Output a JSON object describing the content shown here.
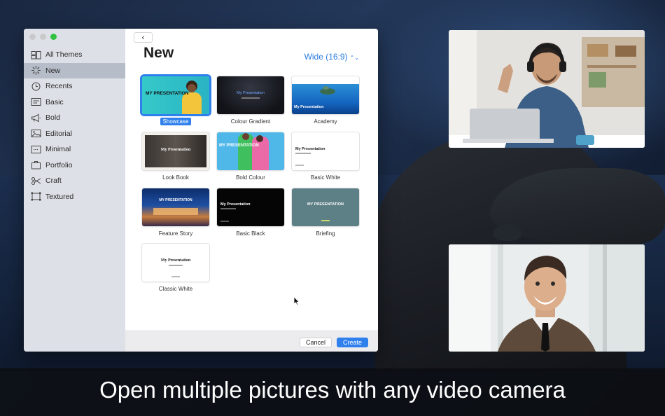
{
  "sidebar": {
    "items": [
      {
        "label": "All Themes",
        "icon": "all-themes-icon"
      },
      {
        "label": "New",
        "icon": "sparkle-icon"
      },
      {
        "label": "Recents",
        "icon": "clock-icon"
      },
      {
        "label": "Basic",
        "icon": "basic-slide-icon"
      },
      {
        "label": "Bold",
        "icon": "megaphone-icon"
      },
      {
        "label": "Editorial",
        "icon": "image-icon"
      },
      {
        "label": "Minimal",
        "icon": "minimal-icon"
      },
      {
        "label": "Portfolio",
        "icon": "briefcase-icon"
      },
      {
        "label": "Craft",
        "icon": "scissors-icon"
      },
      {
        "label": "Textured",
        "icon": "textured-icon"
      }
    ],
    "selected": "New"
  },
  "main": {
    "back_label": "‹",
    "title": "New",
    "aspect_label": "Wide (16:9)",
    "aspect_arrows": "⌃⌄",
    "themes": [
      {
        "label": "Showcase",
        "thumb_title": "MY PRESENTATION",
        "selected": true
      },
      {
        "label": "Colour Gradient",
        "thumb_title": "My Presentation"
      },
      {
        "label": "Academy",
        "thumb_title": "My Presentation"
      },
      {
        "label": "Look Book",
        "thumb_title": "My Presentation"
      },
      {
        "label": "Bold Colour",
        "thumb_title": "MY PRESENTATION"
      },
      {
        "label": "Basic White",
        "thumb_title": "My Presentation"
      },
      {
        "label": "Feature Story",
        "thumb_title": "MY PRESENTATION"
      },
      {
        "label": "Basic Black",
        "thumb_title": "My Presentation"
      },
      {
        "label": "Briefing",
        "thumb_title": "MY PRESENTATION"
      },
      {
        "label": "Classic White",
        "thumb_title": "My Presentation"
      }
    ]
  },
  "footer": {
    "cancel_label": "Cancel",
    "create_label": "Create"
  },
  "caption": "Open multiple pictures with any video camera",
  "colors": {
    "accent": "#2f80ed",
    "sidebar_bg": "#dde0e6",
    "sidebar_selected": "#b6bcc8"
  }
}
